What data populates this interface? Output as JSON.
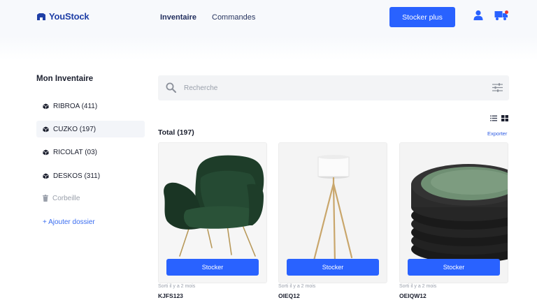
{
  "header": {
    "logo_text": "YouStock",
    "nav": [
      {
        "label": "Inventaire",
        "active": true
      },
      {
        "label": "Commandes",
        "active": false
      }
    ],
    "cta_label": "Stocker plus",
    "icons": [
      "user-icon",
      "truck-icon"
    ],
    "accent_color": "#2962ff"
  },
  "sidebar": {
    "title": "Mon Inventaire",
    "items": [
      {
        "label": "RIBROA (411)",
        "icon": "box-icon",
        "selected": false
      },
      {
        "label": "CUZKO (197)",
        "icon": "box-icon",
        "selected": true
      },
      {
        "label": "RICOLAT (03)",
        "icon": "box-icon",
        "selected": false
      },
      {
        "label": "DESKOS (311)",
        "icon": "box-icon",
        "selected": false
      },
      {
        "label": "Corbeille",
        "icon": "trash-icon",
        "selected": false
      },
      {
        "label": "+ Ajouter dossier",
        "icon": "",
        "selected": false
      }
    ]
  },
  "search": {
    "placeholder": "Recherche"
  },
  "main": {
    "total_label": "Total (197)",
    "export_label": "Exporter",
    "products": [
      {
        "image": "armchair",
        "button": "Stocker",
        "meta": "Sorti il y a 2 mois",
        "code": "KJFS123"
      },
      {
        "image": "floor-lamp",
        "button": "Stocker",
        "meta": "Sorti il y a 2 mois",
        "code": "OIEQ12"
      },
      {
        "image": "plates",
        "button": "Stocker",
        "meta": "Sorti il y a 2 mois",
        "code": "OEIQW12"
      }
    ]
  }
}
